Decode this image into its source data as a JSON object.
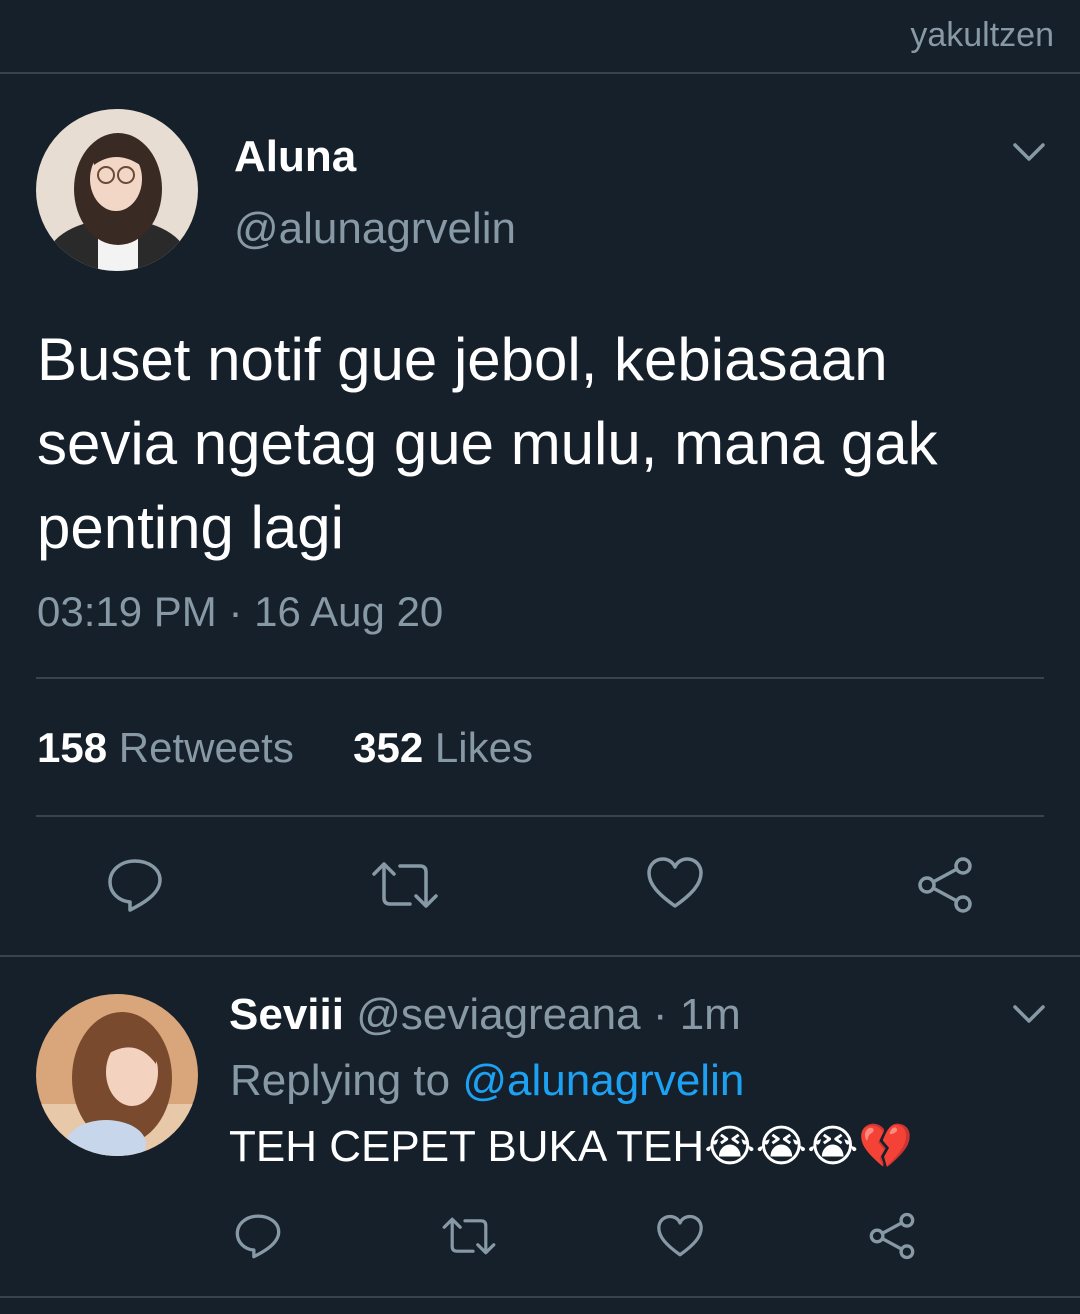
{
  "watermark": "yakultzen",
  "tweet": {
    "author_name": "Aluna",
    "author_handle": "@alunagrvelin",
    "text_lines": [
      "Buset notif gue jebol, kebiasaan",
      "sevia ngetag gue mulu, mana gak",
      "penting lagi"
    ],
    "timestamp": "03:19 PM · 16 Aug 20",
    "retweets_count": "158",
    "retweets_label": "Retweets",
    "likes_count": "352",
    "likes_label": "Likes"
  },
  "reply": {
    "author_name": "Seviii",
    "author_handle": "@seviagreana",
    "time_ago": "· 1m",
    "replying_prefix": "Replying to",
    "replying_mention": "@alunagrvelin",
    "text": "TEH CEPET BUKA TEH",
    "emojis": "😭😭😭💔"
  },
  "icons": {
    "chevron": "chevron-down-icon",
    "reply": "reply-icon",
    "retweet": "retweet-icon",
    "like": "heart-icon",
    "share": "share-icon"
  },
  "colors": {
    "background": "#15202b",
    "divider": "#38444d",
    "secondary_text": "#8899a6",
    "link": "#1da1f2",
    "icon": "#8899a6"
  }
}
